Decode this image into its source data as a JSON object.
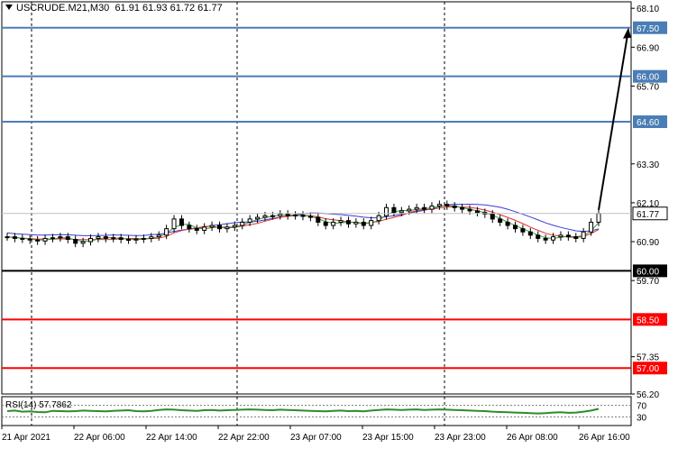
{
  "header": {
    "symbol_timeframe": "USCRUDE.M21,M30",
    "ohlc": "61.91 61.93 61.72 61.77"
  },
  "price_axis": {
    "ticks": [
      "68.10",
      "66.90",
      "65.70",
      "63.30",
      "62.10",
      "60.90",
      "59.70",
      "57.35",
      "56.20"
    ],
    "current_price": "61.77"
  },
  "horizontal_levels": [
    {
      "price": "67.50",
      "color": "#4a7db5"
    },
    {
      "price": "66.00",
      "color": "#4a7db5"
    },
    {
      "price": "64.60",
      "color": "#4a7db5"
    },
    {
      "price": "60.00",
      "color": "#000000"
    },
    {
      "price": "58.50",
      "color": "#ff0000"
    },
    {
      "price": "57.00",
      "color": "#ff0000"
    }
  ],
  "rsi_panel": {
    "label": "RSI(14) 57.7862",
    "scale": [
      "70",
      "30"
    ],
    "color": "#2e8b2e"
  },
  "time_axis": {
    "labels": [
      "21 Apr 2021",
      "22 Apr 06:00",
      "22 Apr 14:00",
      "22 Apr 22:00",
      "23 Apr 07:00",
      "23 Apr 15:00",
      "23 Apr 23:00",
      "26 Apr 08:00",
      "26 Apr 16:00"
    ]
  },
  "chart_data": {
    "type": "candlestick",
    "symbol": "USCRUDE.M21",
    "timeframe": "M30",
    "ylim": [
      56.2,
      68.3
    ],
    "close_series": [
      61.05,
      61.0,
      60.98,
      60.95,
      60.92,
      61.0,
      61.02,
      61.05,
      60.97,
      60.85,
      60.9,
      61.0,
      61.05,
      61.0,
      61.02,
      60.97,
      60.95,
      60.98,
      61.0,
      61.05,
      61.1,
      61.3,
      61.6,
      61.4,
      61.3,
      61.25,
      61.35,
      61.4,
      61.3,
      61.35,
      61.4,
      61.5,
      61.6,
      61.65,
      61.7,
      61.7,
      61.75,
      61.7,
      61.72,
      61.68,
      61.65,
      61.5,
      61.4,
      61.5,
      61.55,
      61.45,
      61.5,
      61.4,
      61.55,
      61.7,
      61.95,
      61.8,
      61.85,
      61.9,
      61.95,
      61.9,
      62.0,
      62.05,
      62.0,
      61.95,
      61.9,
      61.85,
      61.8,
      61.75,
      61.6,
      61.5,
      61.4,
      61.3,
      61.2,
      61.1,
      61.0,
      60.95,
      61.05,
      61.1,
      61.05,
      61.0,
      61.2,
      61.5,
      61.77
    ],
    "ma_series": [
      {
        "color": "#3b3bd6"
      },
      {
        "color": "#e03030"
      },
      {
        "color": "#2ea02e"
      }
    ],
    "rsi_series": [
      50,
      52,
      48,
      49,
      47,
      46,
      51,
      50,
      49,
      50,
      52,
      51,
      50,
      49,
      51,
      52,
      53,
      50,
      49,
      51,
      54,
      56,
      55,
      53,
      52,
      51,
      53,
      54,
      52,
      53,
      54,
      55,
      56,
      55,
      54,
      53,
      55,
      54,
      53,
      52,
      51,
      50,
      49,
      51,
      52,
      50,
      51,
      49,
      52,
      54,
      56,
      55,
      54,
      55,
      56,
      54,
      55,
      56,
      55,
      54,
      53,
      52,
      51,
      50,
      48,
      47,
      46,
      45,
      44,
      43,
      42,
      43,
      45,
      46,
      44,
      45,
      48,
      52,
      57.8
    ],
    "annotations": [
      "arrow from last candle up toward 67.50 level"
    ]
  }
}
